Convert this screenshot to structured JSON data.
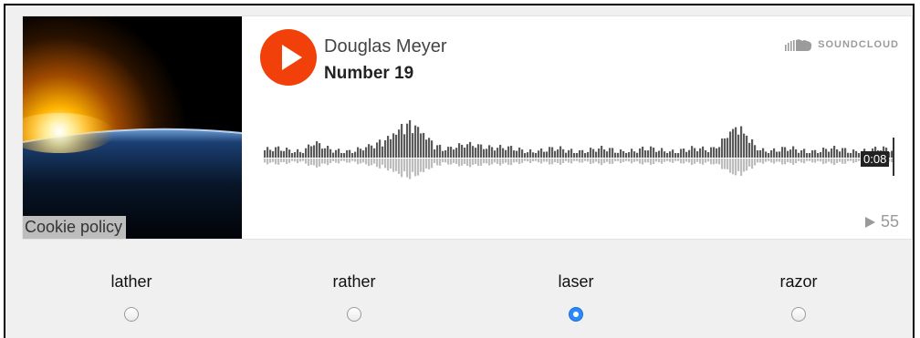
{
  "player": {
    "artist": "Douglas Meyer",
    "title": "Number 19",
    "brand": "SOUNDCLOUD",
    "elapsed": "0:08",
    "play_count": "55",
    "cookie_policy": "Cookie policy",
    "progress_fraction": 0.0,
    "colors": {
      "accent": "#f2400a",
      "waveform": "#5a5a5a",
      "waveform_reflection": "#bdbdbd"
    }
  },
  "options": [
    {
      "label": "lather",
      "selected": false
    },
    {
      "label": "rather",
      "selected": false
    },
    {
      "label": "laser",
      "selected": true
    },
    {
      "label": "razor",
      "selected": false
    }
  ]
}
